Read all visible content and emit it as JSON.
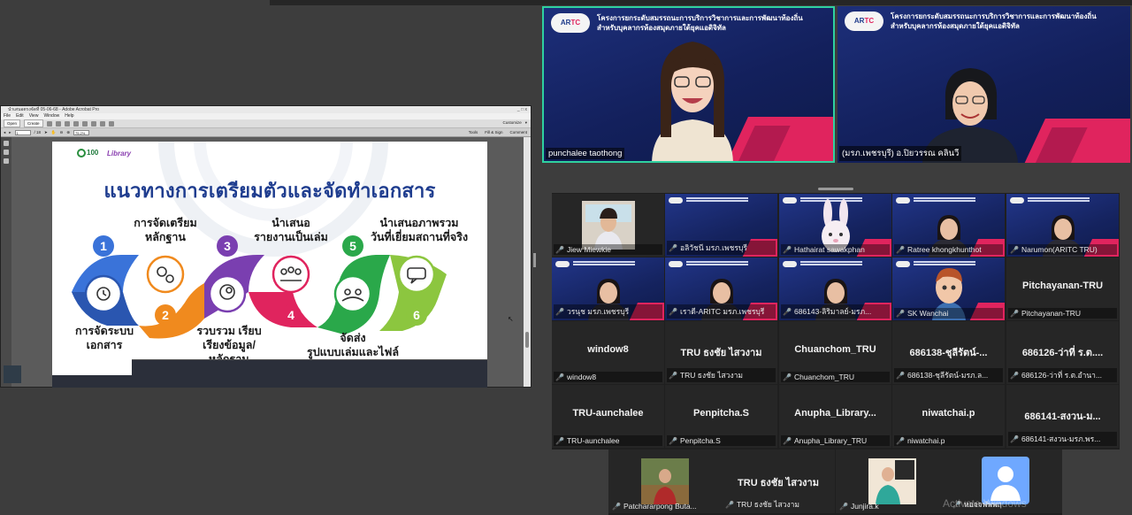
{
  "acrobat": {
    "title": "นำเสนอตรงจัดที่ 05-06-68 - Adobe Acrobat Pro",
    "window_controls": "_ □ x",
    "menu": [
      "File",
      "Edit",
      "View",
      "Window",
      "Help"
    ],
    "toolbar": {
      "open": "Open",
      "create": "Create",
      "customize": "Customize"
    },
    "nav": {
      "page": "1",
      "page_total": "/ 18",
      "zoom": "75.2%"
    },
    "nav_right": [
      "Tools",
      "Fill & Sign",
      "Comment"
    ]
  },
  "slide": {
    "logo_100": "100",
    "logo_library": "Library",
    "heading": "แนวทางการเตรียมตัวและจัดทำเอกสาร",
    "steps": [
      {
        "num": "1",
        "label": "การจัดระบบ\nเอกสาร",
        "color": "#3a73d9"
      },
      {
        "num": "2",
        "label": "การจัดเตรียม\nหลักฐาน",
        "color": "#f08a1e"
      },
      {
        "num": "3",
        "label": "รวบรวม เรียบ\nเรียงข้อมูล/\nหลักฐาน",
        "color": "#7a3fb0"
      },
      {
        "num": "4",
        "label": "นำเสนอ\nรายงานเป็นเล่ม",
        "color": "#e0245e"
      },
      {
        "num": "5",
        "label": "จัดส่ง\nรูปแบบเล่มและไฟล์",
        "color": "#2aa84a"
      },
      {
        "num": "6",
        "label": "นำเสนอภาพรวม\nวันที่เยี่ยมสถานที่จริง",
        "color": "#8cc63f"
      }
    ]
  },
  "speakers": [
    {
      "name": "punchalee taothong",
      "badge_a": "AR",
      "badge_b": "TC",
      "header": "โครงการยกระดับสมรรถนะการบริการวิชาการและการพัฒนาท้องถิ่น\nสำหรับบุคลากรห้องสมุดภายใต้ยุคแอดิจิทัล"
    },
    {
      "name": "(มรภ.เพชรบุรี) อ.ปิยวรรณ คลินวี",
      "badge_a": "AR",
      "badge_b": "TC",
      "header": "โครงการยกระดับสมรรถนะการบริการวิชาการและการพัฒนาท้องถิ่น\nสำหรับบุคลากรห้องสมุดภายใต้ยุคแอดิจิทัล"
    }
  ],
  "gallery": [
    {
      "label": "Jiew Miewkie",
      "big": "",
      "kind": "cam"
    },
    {
      "label": "อลิวัชนี มรภ.เพชรบุรี",
      "big": "",
      "kind": "vid"
    },
    {
      "label": "Hathairat sawakphan",
      "big": "",
      "kind": "bunny"
    },
    {
      "label": "Ratree khongkhunthot",
      "big": "",
      "kind": "vidp"
    },
    {
      "label": "Narumon(ARITC TRU)",
      "big": "",
      "kind": "vidp"
    },
    {
      "label": "วรนุช มรภ.เพชรบุรี",
      "big": "",
      "kind": "vidp"
    },
    {
      "label": "เราดี-ARITC มรภ.เพชรบุรี",
      "big": "",
      "kind": "vidp"
    },
    {
      "label": "686143-ลิริมาลย์-มรภ...",
      "big": "",
      "kind": "vidp"
    },
    {
      "label": "SK Wanchai",
      "big": "",
      "kind": "avatar"
    },
    {
      "label": "Pitchayanan-TRU",
      "big": "Pitchayanan-TRU",
      "kind": "name"
    },
    {
      "label": "window8",
      "big": "window8",
      "kind": "name"
    },
    {
      "label": "TRU ธงชัย ไสวงาม",
      "big": "TRU ธงชัย ไสวงาม",
      "kind": "name"
    },
    {
      "label": "Chuanchom_TRU",
      "big": "Chuanchom_TRU",
      "kind": "name"
    },
    {
      "label": "686138-ชุลีรัตน์-มรภ.ล...",
      "big": "686138-ชุลีรัตน์-...",
      "kind": "name"
    },
    {
      "label": "686126-ว่าที่ ร.ต.อำนา...",
      "big": "686126-ว่าที่ ร.ต....",
      "kind": "name"
    },
    {
      "label": "TRU-aunchalee",
      "big": "TRU-aunchalee",
      "kind": "name"
    },
    {
      "label": "Penpitcha.S",
      "big": "Penpitcha.S",
      "kind": "name"
    },
    {
      "label": "Anupha_Library_TRU",
      "big": "Anupha_Library...",
      "kind": "name"
    },
    {
      "label": "niwatchai.p",
      "big": "niwatchai.p",
      "kind": "name"
    },
    {
      "label": "686141-สงวน-มรภ.พร...",
      "big": "686141-สงวน-ม...",
      "kind": "name"
    }
  ],
  "strip": [
    {
      "label": "Patchararpong Buta...",
      "big": "",
      "kind": "photo"
    },
    {
      "label": "TRU ธงชัย ไสวงาม",
      "big": "TRU ธงชัย ไสวงาม",
      "kind": "name"
    },
    {
      "label": "Junjira.k",
      "big": "",
      "kind": "photo2"
    },
    {
      "label": "หอจจฬพพฤ",
      "big": "",
      "kind": "user"
    }
  ],
  "watermark": "Activate Windows",
  "colors": {
    "accent_active": "#2fd1a0",
    "brand_pink": "#e0245e",
    "brand_blue": "#1d2f7a",
    "heading_blue": "#1f3d8f"
  }
}
